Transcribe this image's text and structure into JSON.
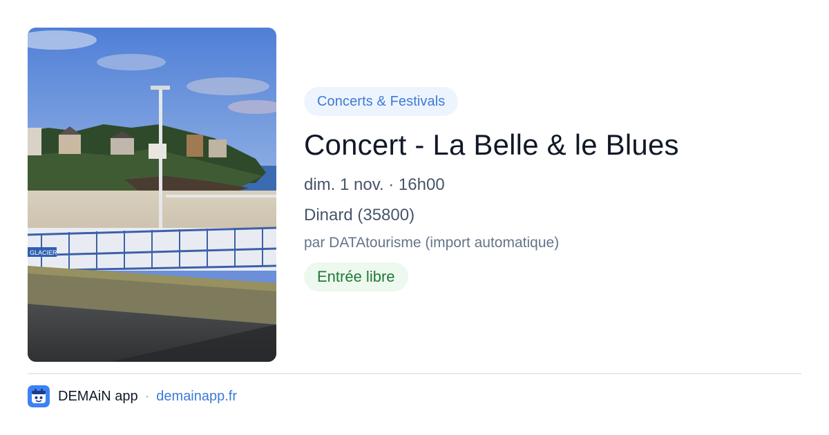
{
  "event": {
    "category": "Concerts & Festivals",
    "title": "Concert - La Belle & le Blues",
    "datetime": "dim. 1 nov. · 16h00",
    "location": "Dinard (35800)",
    "source": "par DATAtourisme (import automatique)",
    "price": "Entrée libre"
  },
  "image": {
    "sign_text": "GLACIER"
  },
  "footer": {
    "app_name": "DEMAiN app",
    "separator": "·",
    "link": "demainapp.fr",
    "logo_icon": "demain-app-logo-icon"
  },
  "colors": {
    "accent": "#3b7ad8",
    "category_bg": "#eef4fd",
    "price_text": "#1f7a36",
    "price_bg": "#edf8ef",
    "logo_bg": "#3b82f6"
  }
}
